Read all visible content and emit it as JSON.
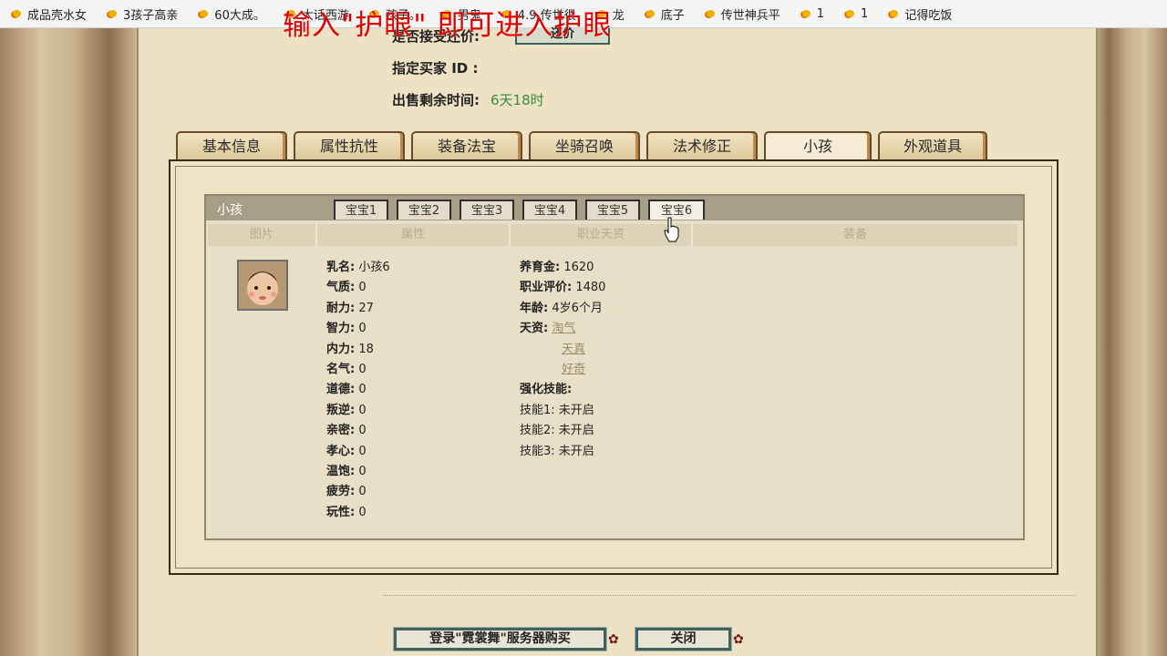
{
  "bookmarks": [
    {
      "label": "成品壳水女"
    },
    {
      "label": "3孩子高亲"
    },
    {
      "label": "60大成。"
    },
    {
      "label": "大话西游"
    },
    {
      "label": "孩子。"
    },
    {
      "label": "男鬼"
    },
    {
      "label": "4.9 传世很"
    },
    {
      "label": "龙"
    },
    {
      "label": "底子"
    },
    {
      "label": "传世神兵平"
    },
    {
      "label": "1"
    },
    {
      "label": "1"
    },
    {
      "label": "记得吃饭"
    }
  ],
  "overlay": {
    "text": "输入\"护眼\" 即可进入护眼"
  },
  "sale_info": {
    "direct_accept_label": "是否接受还价:",
    "counter_button": "还价",
    "buyer_label": "指定买家 ID :",
    "buyer_value": "",
    "remaining_label": "出售剩余时间:",
    "remaining_value": "6天18时"
  },
  "main_tabs": [
    {
      "label": "基本信息"
    },
    {
      "label": "属性抗性"
    },
    {
      "label": "装备法宝"
    },
    {
      "label": "坐骑召唤兽"
    },
    {
      "label": "法术修正"
    },
    {
      "label": "小孩"
    },
    {
      "label": "外观道具"
    }
  ],
  "child_panel": {
    "title": "小孩",
    "subtabs": [
      {
        "label": "宝宝1"
      },
      {
        "label": "宝宝2"
      },
      {
        "label": "宝宝3"
      },
      {
        "label": "宝宝4"
      },
      {
        "label": "宝宝5"
      },
      {
        "label": "宝宝6"
      }
    ],
    "columns": [
      {
        "label": "图片"
      },
      {
        "label": "属性"
      },
      {
        "label": "职业天资"
      },
      {
        "label": "装备"
      }
    ],
    "attributes": [
      {
        "key": "乳名:",
        "value": "小孩6"
      },
      {
        "key": "气质:",
        "value": "0"
      },
      {
        "key": "耐力:",
        "value": "27"
      },
      {
        "key": "智力:",
        "value": "0"
      },
      {
        "key": "内力:",
        "value": "18"
      },
      {
        "key": "名气:",
        "value": "0"
      },
      {
        "key": "道德:",
        "value": "0"
      },
      {
        "key": "叛逆:",
        "value": "0"
      },
      {
        "key": "亲密:",
        "value": "0"
      },
      {
        "key": "孝心:",
        "value": "0"
      },
      {
        "key": "温饱:",
        "value": "0"
      },
      {
        "key": "疲劳:",
        "value": "0"
      },
      {
        "key": "玩性:",
        "value": "0"
      }
    ],
    "career": {
      "yangyu_label": "养育金:",
      "yangyu_value": "1620",
      "rating_label": "职业评价:",
      "rating_value": "1480",
      "age_label": "年龄:",
      "age_value": "4岁6个月",
      "talent_label": "天资:",
      "talents": [
        "淘气",
        "天真",
        "好奇"
      ],
      "skills_label": "强化技能:",
      "skills": [
        {
          "key": "技能1:",
          "value": "未开启"
        },
        {
          "key": "技能2:",
          "value": "未开启"
        },
        {
          "key": "技能3:",
          "value": "未开启"
        }
      ]
    }
  },
  "bottom_buttons": {
    "login_buy": "登录\"霓裳舞\"服务器购买",
    "close": "关闭"
  },
  "colors": {
    "overlay": "#e00000",
    "remaining_time": "#3c8a3c",
    "button_border": "#41615d"
  }
}
